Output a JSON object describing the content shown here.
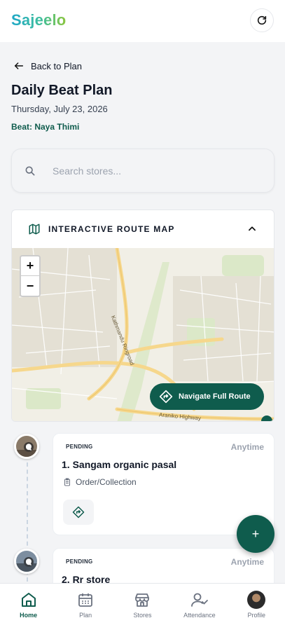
{
  "app": {
    "logo": "Sajeelo"
  },
  "header": {
    "back_label": "Back to Plan",
    "title": "Daily Beat Plan",
    "date": "Thursday, July 23, 2026",
    "beat": "Beat: Naya Thimi"
  },
  "search": {
    "placeholder": "Search stores..."
  },
  "map": {
    "title": "INTERACTIVE ROUTE MAP",
    "navigate_label": "Navigate Full Route",
    "zoom_in": "+",
    "zoom_out": "−",
    "road_labels": [
      "Kathmandu Ringroad",
      "Araniko Highway"
    ],
    "colors": {
      "land": "#f1efe6",
      "major_road": "#f6d78c",
      "green": "#dbe8c8"
    }
  },
  "stops": [
    {
      "status": "PENDING",
      "time": "Anytime",
      "name": "1. Sangam organic pasal",
      "purpose": "Order/Collection"
    },
    {
      "status": "PENDING",
      "time": "Anytime",
      "name": "2. Rr store"
    }
  ],
  "fab": {
    "label": "+"
  },
  "bottom_nav": [
    {
      "label": "Home",
      "icon": "home-icon",
      "active": true
    },
    {
      "label": "Plan",
      "icon": "calendar-icon"
    },
    {
      "label": "Stores",
      "icon": "store-icon"
    },
    {
      "label": "Attendance",
      "icon": "user-check-icon"
    },
    {
      "label": "Profile",
      "icon": "profile-avatar"
    }
  ],
  "colors": {
    "primary": "#0f5c4d",
    "muted": "#9ca3af"
  }
}
